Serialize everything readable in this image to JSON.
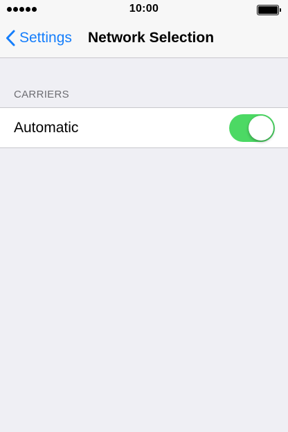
{
  "status_bar": {
    "signal_bars": 5,
    "time": "10:00",
    "battery_level": 1.0
  },
  "nav": {
    "back_label": "Settings",
    "title": "Network Selection",
    "back_icon": "chevron-left-icon",
    "accent_color": "#157efb"
  },
  "sections": [
    {
      "header": "CARRIERS",
      "rows": [
        {
          "label": "Automatic",
          "toggle_on": true,
          "toggle_color": "#4cd964"
        }
      ]
    }
  ]
}
